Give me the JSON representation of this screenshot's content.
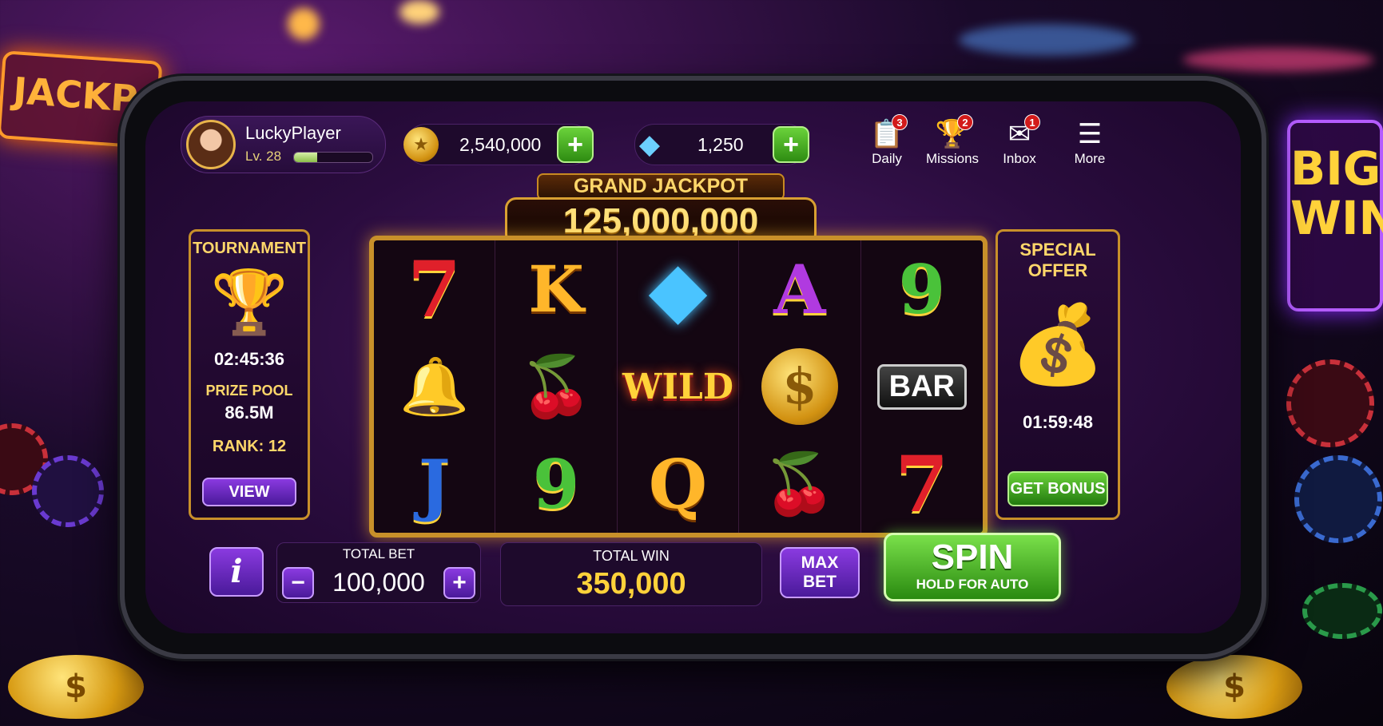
{
  "background": {
    "sign_left": "JACKPOT",
    "sign_right": "BIG WIN"
  },
  "profile": {
    "name": "LuckyPlayer",
    "level": "Lv. 28",
    "xp_fraction": 0.3
  },
  "currency": {
    "coins": "2,540,000",
    "gems": "1,250",
    "add_label": "+"
  },
  "menu": [
    {
      "label": "Daily",
      "icon": "clipboard-icon",
      "badge": "3"
    },
    {
      "label": "Missions",
      "icon": "trophy-icon",
      "badge": "2"
    },
    {
      "label": "Inbox",
      "icon": "envelope-icon",
      "badge": "1"
    },
    {
      "label": "More",
      "icon": "hamburger-icon",
      "badge": ""
    }
  ],
  "jackpot": {
    "title": "GRAND JACKPOT",
    "amount": "125,000,000"
  },
  "reels": [
    [
      "7",
      "K",
      "diamond",
      "A",
      "9"
    ],
    [
      "bell",
      "cherry",
      "WILD",
      "$",
      "BAR"
    ],
    [
      "J",
      "9",
      "Q",
      "cherry",
      "7"
    ]
  ],
  "tournament": {
    "title": "TOURNAMENT",
    "timer": "02:45:36",
    "prize_label": "PRIZE POOL",
    "prize_value": "86.5M",
    "rank": "RANK: 12",
    "button": "VIEW"
  },
  "special_offer": {
    "title_line1": "SPECIAL",
    "title_line2": "OFFER",
    "timer": "01:59:48",
    "button": "GET BONUS"
  },
  "bottom": {
    "info_label": "i",
    "total_bet_label": "TOTAL BET",
    "total_bet": "100,000",
    "minus": "−",
    "plus": "+",
    "total_win_label": "TOTAL WIN",
    "total_win": "350,000",
    "max_bet_line1": "MAX",
    "max_bet_line2": "BET",
    "spin_label": "SPIN",
    "spin_sub": "HOLD FOR AUTO"
  },
  "colors": {
    "accent_gold": "#ffd76a",
    "purple": "#4a1a9a",
    "green": "#2e8c12"
  }
}
